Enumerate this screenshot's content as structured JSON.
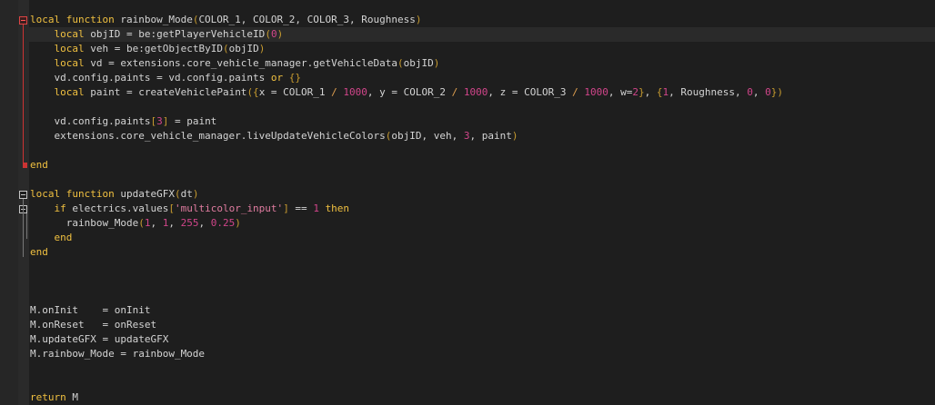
{
  "editor": {
    "lines": [
      [
        {
          "t": "local function",
          "c": "kw"
        },
        {
          "t": " rainbow_Mode"
        },
        {
          "t": "(",
          "c": "br"
        },
        {
          "t": "COLOR_1, COLOR_2, COLOR_3, Roughness"
        },
        {
          "t": ")",
          "c": "br"
        }
      ],
      [
        {
          "t": "    "
        },
        {
          "t": "local",
          "c": "kw"
        },
        {
          "t": " objID = be:getPlayerVehicleID"
        },
        {
          "t": "(",
          "c": "br"
        },
        {
          "t": "0",
          "c": "num"
        },
        {
          "t": ")",
          "c": "br"
        }
      ],
      [
        {
          "t": "    "
        },
        {
          "t": "local",
          "c": "kw"
        },
        {
          "t": " veh = be:getObjectByID"
        },
        {
          "t": "(",
          "c": "br"
        },
        {
          "t": "objID"
        },
        {
          "t": ")",
          "c": "br"
        }
      ],
      [
        {
          "t": "    "
        },
        {
          "t": "local",
          "c": "kw"
        },
        {
          "t": " vd = extensions.core_vehicle_manager.getVehicleData"
        },
        {
          "t": "(",
          "c": "br"
        },
        {
          "t": "objID"
        },
        {
          "t": ")",
          "c": "br"
        }
      ],
      [
        {
          "t": "    vd.config.paints = vd.config.paints "
        },
        {
          "t": "or",
          "c": "kw"
        },
        {
          "t": " "
        },
        {
          "t": "{}",
          "c": "br"
        }
      ],
      [
        {
          "t": "    "
        },
        {
          "t": "local",
          "c": "kw"
        },
        {
          "t": " paint = createVehiclePaint"
        },
        {
          "t": "({",
          "c": "br"
        },
        {
          "t": "x = COLOR_1 "
        },
        {
          "t": "/",
          "c": "punc"
        },
        {
          "t": " "
        },
        {
          "t": "1000",
          "c": "num"
        },
        {
          "t": ", y = COLOR_2 "
        },
        {
          "t": "/",
          "c": "punc"
        },
        {
          "t": " "
        },
        {
          "t": "1000",
          "c": "num"
        },
        {
          "t": ", z = COLOR_3 "
        },
        {
          "t": "/",
          "c": "punc"
        },
        {
          "t": " "
        },
        {
          "t": "1000",
          "c": "num"
        },
        {
          "t": ", w="
        },
        {
          "t": "2",
          "c": "num"
        },
        {
          "t": "}",
          "c": "br"
        },
        {
          "t": ", "
        },
        {
          "t": "{",
          "c": "br"
        },
        {
          "t": "1",
          "c": "num"
        },
        {
          "t": ", Roughness, "
        },
        {
          "t": "0",
          "c": "num"
        },
        {
          "t": ", "
        },
        {
          "t": "0",
          "c": "num"
        },
        {
          "t": "})",
          "c": "br"
        }
      ],
      [
        {
          "t": ""
        }
      ],
      [
        {
          "t": "    vd.config.paints"
        },
        {
          "t": "[",
          "c": "br"
        },
        {
          "t": "3",
          "c": "num"
        },
        {
          "t": "]",
          "c": "br"
        },
        {
          "t": " = paint"
        }
      ],
      [
        {
          "t": "    extensions.core_vehicle_manager.liveUpdateVehicleColors"
        },
        {
          "t": "(",
          "c": "br"
        },
        {
          "t": "objID, veh, "
        },
        {
          "t": "3",
          "c": "num"
        },
        {
          "t": ", paint"
        },
        {
          "t": ")",
          "c": "br"
        }
      ],
      [
        {
          "t": ""
        }
      ],
      [
        {
          "t": "end",
          "c": "kw"
        }
      ],
      [
        {
          "t": ""
        }
      ],
      [
        {
          "t": "local function",
          "c": "kw"
        },
        {
          "t": " updateGFX"
        },
        {
          "t": "(",
          "c": "br"
        },
        {
          "t": "dt"
        },
        {
          "t": ")",
          "c": "br"
        }
      ],
      [
        {
          "t": "    "
        },
        {
          "t": "if",
          "c": "kw"
        },
        {
          "t": " electrics.values"
        },
        {
          "t": "[",
          "c": "br"
        },
        {
          "t": "'multicolor_input'",
          "c": "str"
        },
        {
          "t": "]",
          "c": "br"
        },
        {
          "t": " == "
        },
        {
          "t": "1",
          "c": "num"
        },
        {
          "t": " "
        },
        {
          "t": "then",
          "c": "kw"
        }
      ],
      [
        {
          "t": "      rainbow_Mode"
        },
        {
          "t": "(",
          "c": "br"
        },
        {
          "t": "1",
          "c": "num"
        },
        {
          "t": ", "
        },
        {
          "t": "1",
          "c": "num"
        },
        {
          "t": ", "
        },
        {
          "t": "255",
          "c": "num"
        },
        {
          "t": ", "
        },
        {
          "t": "0.25",
          "c": "num"
        },
        {
          "t": ")",
          "c": "br"
        }
      ],
      [
        {
          "t": "    "
        },
        {
          "t": "end",
          "c": "kw"
        }
      ],
      [
        {
          "t": "end",
          "c": "kw"
        }
      ],
      [
        {
          "t": ""
        }
      ],
      [
        {
          "t": ""
        }
      ],
      [
        {
          "t": ""
        }
      ],
      [
        {
          "t": "M.onInit    = onInit"
        }
      ],
      [
        {
          "t": "M.onReset   = onReset"
        }
      ],
      [
        {
          "t": "M.updateGFX = updateGFX"
        }
      ],
      [
        {
          "t": "M.rainbow_Mode = rainbow_Mode"
        }
      ],
      [
        {
          "t": ""
        }
      ],
      [
        {
          "t": ""
        }
      ],
      [
        {
          "t": "return",
          "c": "kw"
        },
        {
          "t": " M"
        }
      ]
    ]
  },
  "colors": {
    "background": "#1e1e1e",
    "keyword": "#f0c040",
    "number": "#d1458a",
    "string": "#e07ca0",
    "bracket": "#c79b2f",
    "text": "#d4d4d4",
    "fold_marker_active": "#ff5555"
  }
}
